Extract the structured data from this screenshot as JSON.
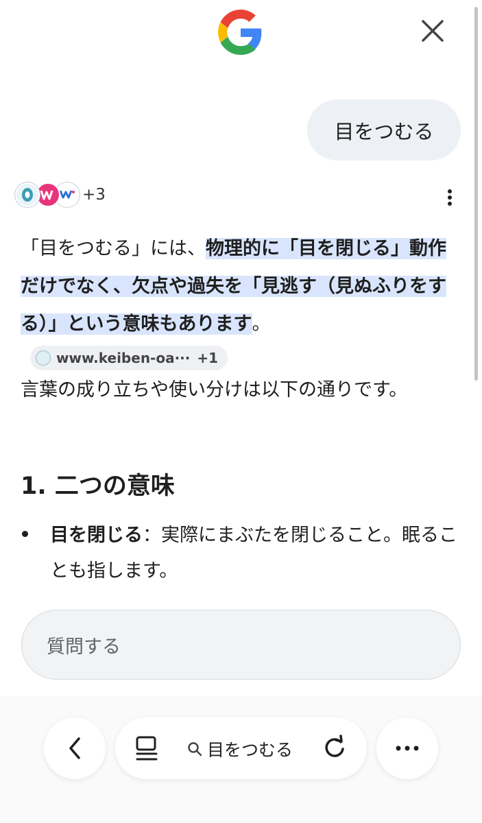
{
  "app": {
    "brand_letter": "G",
    "colors": {
      "blue": "#4285F4",
      "red": "#EA4335",
      "yellow": "#FBBC05",
      "green": "#34A853",
      "highlight": "#d9e5fc"
    }
  },
  "header": {
    "close_icon": "close-icon"
  },
  "conversation": {
    "user_query": "目をつむる",
    "sources": {
      "more_count": "+3"
    },
    "answer": {
      "part_plain_1": "「目をつむる」には、",
      "part_highlight": "物理的に「目を閉じる」動作だけでなく、欠点や過失を「見逃す（見ぬふりをする）」という意味もあります",
      "part_plain_2": "。",
      "citation_domain": "www.keiben-oa···",
      "citation_extra": "+1"
    },
    "paragraph": "言葉の成り立ちや使い分けは以下の通りです。",
    "heading": "1. 二つの意味",
    "bullets": [
      {
        "term": "目を閉じる",
        "text": "：実際にまぶたを閉じること。眠ることも指します。"
      }
    ]
  },
  "input": {
    "placeholder": "質問する"
  },
  "bottom_nav": {
    "query": "目をつむる",
    "back_icon": "back-arrow-icon",
    "tabs_icon": "tabs-icon",
    "reload_icon": "reload-icon",
    "more_icon": "more-horizontal-icon"
  }
}
